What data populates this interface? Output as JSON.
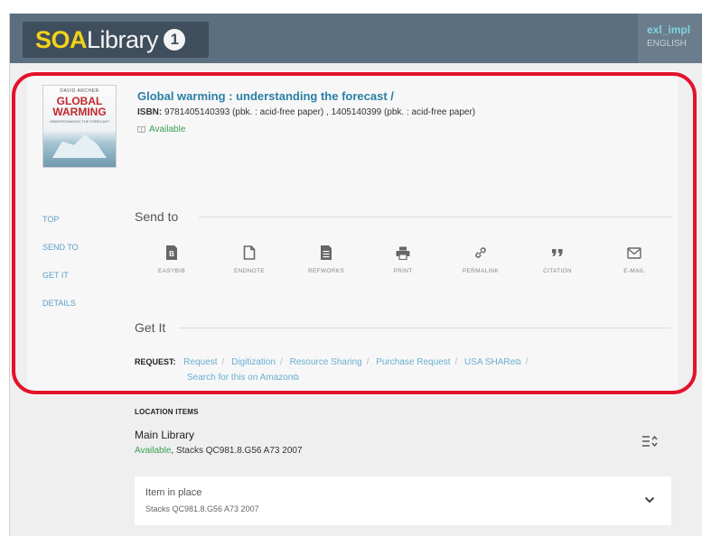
{
  "header": {
    "logo_soa": "SOA",
    "logo_lib": "Library",
    "logo_badge": "1",
    "user": "exl_impl",
    "language": "ENGLISH"
  },
  "record": {
    "cover_author": "DAVID ARCHER",
    "cover_title_1": "GLOBAL",
    "cover_title_2": "WARMING",
    "cover_subtitle": "UNDERSTANDING THE FORECAST",
    "title": "Global warming : understanding the forecast /",
    "isbn_label": "ISBN:",
    "isbn_value": "9781405140393 (pbk. : acid-free paper) , 1405140399 (pbk. : acid-free paper)",
    "availability": "Available"
  },
  "sidenav": {
    "top": "TOP",
    "send_to": "SEND TO",
    "get_it": "GET IT",
    "details": "DETAILS"
  },
  "send_to": {
    "heading": "Send to",
    "items": [
      {
        "label": "EASYBIB",
        "icon": "easybib-icon"
      },
      {
        "label": "ENDNOTE",
        "icon": "document-icon"
      },
      {
        "label": "REFWORKS",
        "icon": "refworks-icon"
      },
      {
        "label": "PRINT",
        "icon": "printer-icon"
      },
      {
        "label": "PERMALINK",
        "icon": "link-icon"
      },
      {
        "label": "CITATION",
        "icon": "quote-icon"
      },
      {
        "label": "E-MAIL",
        "icon": "envelope-icon"
      }
    ]
  },
  "get_it": {
    "heading": "Get It",
    "request_label": "REQUEST:",
    "links": [
      "Request",
      "Digitization",
      "Resource Sharing",
      "Purchase Request",
      "USA SHARe"
    ],
    "amazon": "Search for this on Amazon",
    "separator": "/"
  },
  "location": {
    "heading": "LOCATION ITEMS",
    "library": "Main Library",
    "status": "Available",
    "shelf": ", Stacks QC981.8.G56 A73 2007",
    "item_title": "Item in place",
    "item_location": "Stacks QC981.8.G56 A73 2007"
  }
}
